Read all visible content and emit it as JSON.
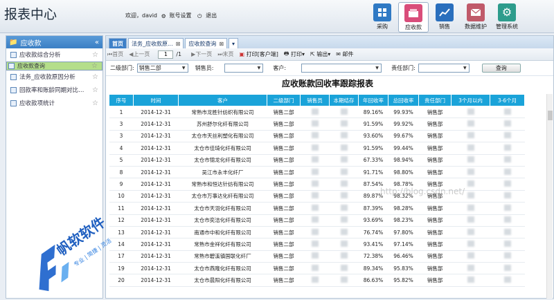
{
  "app": {
    "title": "报表中心"
  },
  "user": {
    "welcome": "欢迎，david",
    "settings": "账号设置",
    "logout": "退出"
  },
  "modules": [
    {
      "label": "采购",
      "color": "#2f79c4",
      "icon": "grid-icon"
    },
    {
      "label": "应收款",
      "color": "#d94d7a",
      "icon": "box-icon",
      "active": true
    },
    {
      "label": "销售",
      "color": "#2a6fbd",
      "icon": "chart-icon"
    },
    {
      "label": "数据维护",
      "color": "#c05a6a",
      "icon": "mail-icon"
    },
    {
      "label": "管理系统",
      "color": "#2d9c8c",
      "icon": "gear-icon"
    }
  ],
  "sidebar": {
    "title": "应收款",
    "items": [
      {
        "label": "应收款综合分析"
      },
      {
        "label": "应收款查询",
        "selected": true
      },
      {
        "label": "法务_应收款原因分析"
      },
      {
        "label": "回款率和账龄同期对比…"
      },
      {
        "label": "应收款项统计"
      }
    ]
  },
  "tabs": [
    {
      "label": "首页"
    },
    {
      "label": "法务_应收款原..."
    },
    {
      "label": "应收款查询"
    }
  ],
  "toolbar": {
    "first": "首页",
    "prev": "上一页",
    "page": "1",
    "total": "/1",
    "next": "下一页",
    "last": "末页",
    "print_client": "打印[客户端]",
    "print": "打印",
    "export": "输出",
    "mail": "邮件"
  },
  "filters": {
    "dept_label": "二级部门:",
    "dept_value": "销售二部",
    "sales_label": "销售员:",
    "customer_label": "客户:",
    "resp_label": "责任部门:",
    "query_button": "查询"
  },
  "report": {
    "title": "应收账款回收率跟踪报表",
    "columns": [
      "序号",
      "时间",
      "客户",
      "二级部门",
      "销售员",
      "本期结存",
      "年回收率",
      "总回收率",
      "责任部门",
      "3个月以内",
      "3-6个月"
    ],
    "rows": [
      [
        "1",
        "2014-12-31",
        "常熟市龙胜针纺织有限公司",
        "销售二部",
        "",
        "",
        "89.16%",
        "99.93%",
        "销售部",
        "",
        ""
      ],
      [
        "3",
        "2014-12-31",
        "苏州舒尔化纤有限公司",
        "销售二部",
        "",
        "",
        "91.59%",
        "99.92%",
        "销售部",
        "",
        ""
      ],
      [
        "3",
        "2014-12-31",
        "太仓市天丝利塑化有限公司",
        "销售二部",
        "",
        "",
        "93.60%",
        "99.67%",
        "销售部",
        "",
        ""
      ],
      [
        "4",
        "2014-12-31",
        "太仓市佳琦化纤有限公司",
        "销售二部",
        "",
        "",
        "91.59%",
        "99.44%",
        "销售部",
        "",
        ""
      ],
      [
        "5",
        "2014-12-31",
        "太仓市锦龙化纤有限公司",
        "销售二部",
        "",
        "",
        "67.33%",
        "98.94%",
        "销售部",
        "",
        ""
      ],
      [
        "8",
        "2014-12-31",
        "吴江市永丰化纤厂",
        "销售二部",
        "",
        "",
        "91.71%",
        "98.80%",
        "销售部",
        "",
        ""
      ],
      [
        "9",
        "2014-12-31",
        "常熟市和恒达针纺有限公司",
        "销售二部",
        "",
        "",
        "87.54%",
        "98.78%",
        "销售部",
        "",
        ""
      ],
      [
        "10",
        "2014-12-31",
        "太仓市万事达化纤有限公司",
        "销售二部",
        "",
        "",
        "89.87%",
        "98.32%",
        "销售部",
        "",
        ""
      ],
      [
        "11",
        "2014-12-31",
        "太仓市天羽化纤有限公司",
        "销售二部",
        "",
        "",
        "87.39%",
        "98.28%",
        "销售部",
        "",
        ""
      ],
      [
        "12",
        "2014-12-31",
        "太仓市奕洁化纤有限公司",
        "销售二部",
        "",
        "",
        "93.69%",
        "98.23%",
        "销售部",
        "",
        ""
      ],
      [
        "13",
        "2014-12-31",
        "南通市中和化纤有限公司",
        "销售二部",
        "",
        "",
        "76.74%",
        "97.80%",
        "销售部",
        "",
        ""
      ],
      [
        "14",
        "2014-12-31",
        "常熟市金祥化纤有限公司",
        "销售二部",
        "",
        "",
        "93.41%",
        "97.14%",
        "销售部",
        "",
        ""
      ],
      [
        "17",
        "2014-12-31",
        "常熟市碧溪镇国联化纤厂",
        "销售二部",
        "",
        "",
        "72.38%",
        "96.46%",
        "销售部",
        "",
        ""
      ],
      [
        "19",
        "2014-12-31",
        "太仓市燕隆化纤有限公司",
        "销售二部",
        "",
        "",
        "89.34%",
        "95.83%",
        "销售部",
        "",
        ""
      ],
      [
        "20",
        "2014-12-31",
        "太仓市晨阳化纤有限公司",
        "销售二部",
        "",
        "",
        "86.63%",
        "95.82%",
        "销售部",
        "",
        ""
      ]
    ]
  },
  "watermark": {
    "brand": "帆软软件",
    "tagline": "专业 | 简捷 | 灵活",
    "url": "http://blog.csdn.net/"
  }
}
